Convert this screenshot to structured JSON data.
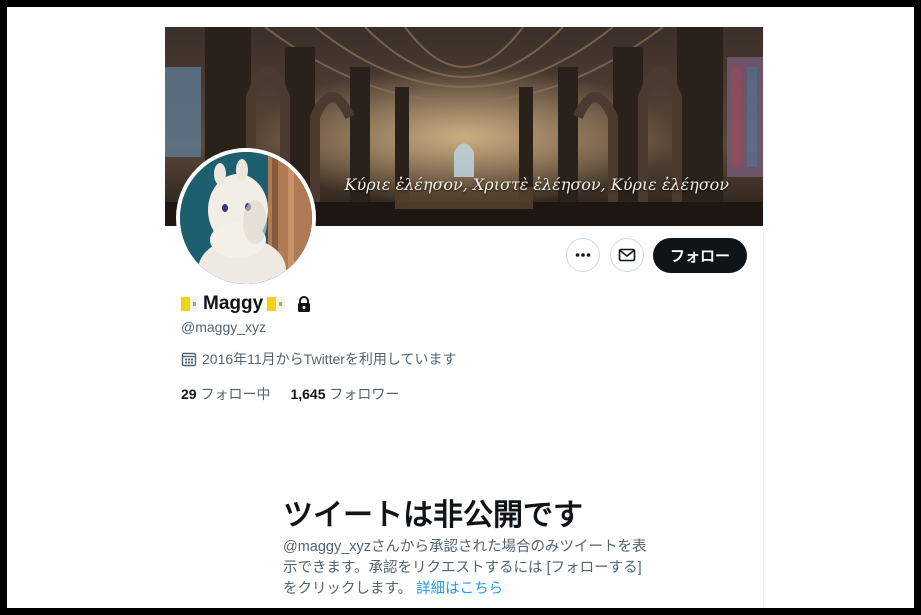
{
  "banner": {
    "caption": "Κύριε ἐλέησον, Χριστὲ ἐλέησον, Κύριε ἐλέησον"
  },
  "actions": {
    "more_icon": "more-icon",
    "message_icon": "envelope-icon",
    "follow_label": "フォロー"
  },
  "profile": {
    "display_name": "Maggy",
    "flag_emoji_name": "vatican-flag-icon",
    "handle": "@maggy_xyz",
    "joined": "2016年11月からTwitterを利用しています",
    "following_count": "29",
    "following_label": "フォロー中",
    "followers_count": "1,645",
    "followers_label": "フォロワー"
  },
  "private_notice": {
    "title": "ツイートは非公開です",
    "body": "@maggy_xyzさんから承認された場合のみツイートを表示できます。承認をリクエストするには [フォローする] をクリックします。",
    "link": "詳細はこちら"
  },
  "colors": {
    "accent": "#1d9bf0",
    "text_primary": "#0f1419",
    "text_secondary": "#536471",
    "follow_button": "#0f1419"
  }
}
